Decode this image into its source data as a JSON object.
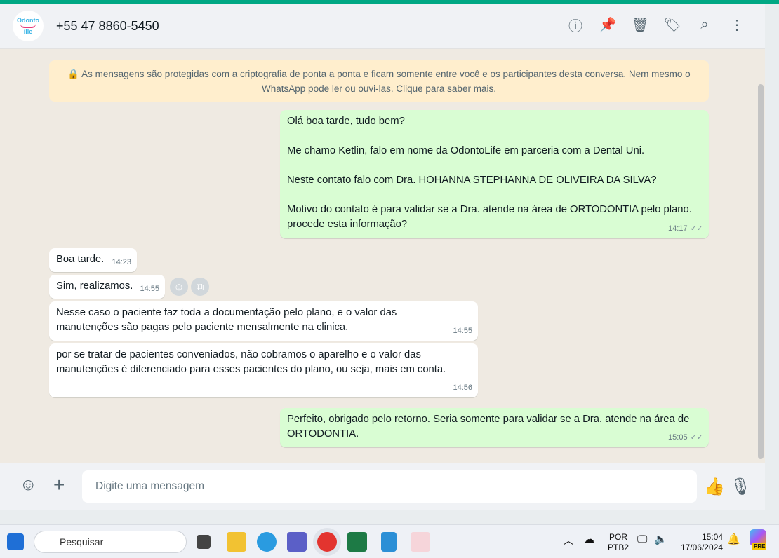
{
  "header": {
    "contact": "+55 47 8860-5450",
    "avatar_text_top": "Odonto",
    "avatar_text_bottom": "ille"
  },
  "encryption_notice": "🔒 As mensagens são protegidas com a criptografia de ponta a ponta e ficam somente entre você e os participantes desta conversa. Nem mesmo o WhatsApp pode ler ou ouvi-las. Clique para saber mais.",
  "messages": [
    {
      "dir": "out",
      "paragraphs": [
        "Olá boa tarde, tudo bem?",
        "Me chamo Ketlin, falo em nome da OdontoLife em parceria com a Dental Uni.",
        "Neste contato falo com Dra. HOHANNA STEPHANNA DE OLIVEIRA DA SILVA?",
        "Motivo do contato é para validar se a Dra. atende na área de ORTODONTIA pelo plano. procede esta informação?"
      ],
      "time": "14:17"
    },
    {
      "dir": "in",
      "text": "Boa tarde.",
      "time": "14:23"
    },
    {
      "dir": "in",
      "text": "Sim, realizamos.",
      "time": "14:55"
    },
    {
      "dir": "in",
      "text": "Nesse caso o paciente faz toda a documentação pelo plano, e o valor das manutenções são pagas pelo paciente mensalmente na clinica.",
      "time": "14:55"
    },
    {
      "dir": "in",
      "text": "por se tratar de pacientes conveniados, não cobramos o aparelho e o valor das manutenções é diferenciado para esses pacientes do plano, ou seja, mais em conta.",
      "time": "14:56"
    },
    {
      "dir": "out",
      "text": "Perfeito, obrigado pelo retorno. Seria somente para validar se a Dra. atende na área de ORTODONTIA.",
      "time": "15:05"
    }
  ],
  "composer": {
    "placeholder": "Digite uma mensagem"
  },
  "taskbar": {
    "search": "Pesquisar",
    "lang1": "POR",
    "lang2": "PTB2",
    "time": "15:04",
    "date": "17/06/2024",
    "copilot_badge": "PRE"
  },
  "colors": {
    "accent": "#00a884",
    "outgoing": "#d9fdd3",
    "notice": "#ffeecd"
  }
}
